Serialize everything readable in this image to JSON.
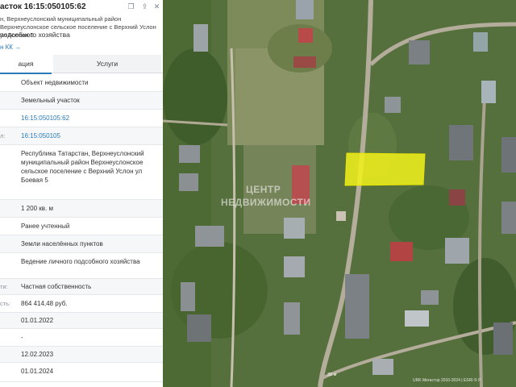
{
  "header": {
    "title": "асток 16:15:050105:62",
    "address": "н, Верхнеуслонский муниципальный район Верхнеуслонское сельское поселение с Верхний Услон ул Боевая 5",
    "use": "подсобного хозяйства",
    "link": "н КК →"
  },
  "tabs": [
    {
      "label": "ация"
    },
    {
      "label": "Услуги"
    }
  ],
  "rows": [
    {
      "label": "",
      "value": "Объект недвижимости"
    },
    {
      "label": "",
      "value": "Земельный участок"
    },
    {
      "label": "",
      "value": "16:15:050105:62"
    },
    {
      "label": "л:",
      "value": "16:15:050105"
    },
    {
      "label": "",
      "value": "Республика Татарстан, Верхнеуслонский муниципальный район Верхнеуслонское сельское поселение с Верхний Услон ул Боевая 5"
    },
    {
      "label": "",
      "value": "1 200 кв. м"
    },
    {
      "label": "",
      "value": "Ранее учтенный"
    },
    {
      "label": "",
      "value": "Земли населённых пунктов"
    },
    {
      "label": "",
      "value": "Ведение личного подсобного хозяйства"
    },
    {
      "label": "ти:",
      "value": "Частная собственность"
    },
    {
      "label": "сть:",
      "value": "864 414,48 руб."
    },
    {
      "label": "",
      "value": "01.01.2022"
    },
    {
      "label": "",
      "value": "-"
    },
    {
      "label": "",
      "value": "12.02.2023"
    },
    {
      "label": "",
      "value": "01.01.2024"
    }
  ],
  "map": {
    "watermark_line1": "ЦЕНТР",
    "watermark_line2": "НЕДВИЖИМОСТИ",
    "scale_label": "30 м",
    "attribution": "URK Мегастэр 2010-2024 | ESRI © Р",
    "parcel_color": "#f2f21a"
  }
}
